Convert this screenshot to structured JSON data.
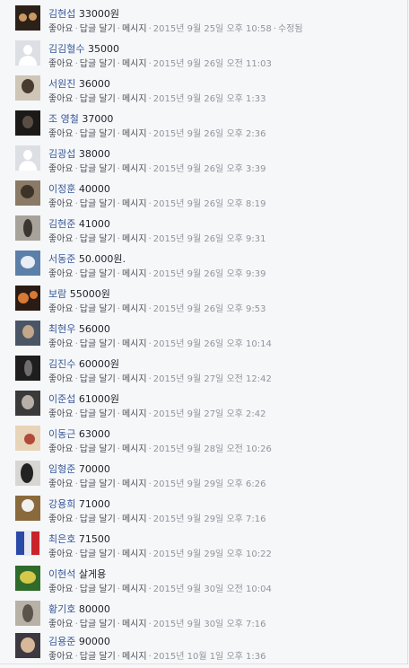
{
  "labels": {
    "like": "좋아요",
    "reply": "답글 달기",
    "message": "메시지",
    "edited": "수정됨"
  },
  "comments": [
    {
      "name": "김현섭",
      "text": "33000원",
      "time": "2015년 9월 25일 오후 10:58",
      "edited": true,
      "avatar": "photo",
      "avatar_color": "#2b2119",
      "accent": "#c99a63"
    },
    {
      "name": "김김혈수",
      "text": "35000",
      "time": "2015년 9월 26일 오전 11:03",
      "edited": false,
      "avatar": "default",
      "avatar_color": "#dcdfe4",
      "accent": "#ffffff"
    },
    {
      "name": "서원진",
      "text": "36000",
      "time": "2015년 9월 26일 오후 1:33",
      "edited": false,
      "avatar": "photo",
      "avatar_color": "#cfc6b8",
      "accent": "#4a3b30"
    },
    {
      "name": "조 영철",
      "text": "37000",
      "time": "2015년 9월 26일 오후 2:36",
      "edited": false,
      "avatar": "photo",
      "avatar_color": "#1b1a18",
      "accent": "#5a4e44"
    },
    {
      "name": "김광섭",
      "text": "38000",
      "time": "2015년 9월 26일 오후 3:39",
      "edited": false,
      "avatar": "default",
      "avatar_color": "#dcdfe4",
      "accent": "#ffffff"
    },
    {
      "name": "이정훈",
      "text": "40000",
      "time": "2015년 9월 26일 오후 8:19",
      "edited": false,
      "avatar": "photo",
      "avatar_color": "#8a7a66",
      "accent": "#3e3329"
    },
    {
      "name": "김현준",
      "text": "41000",
      "time": "2015년 9월 26일 오후 9:31",
      "edited": false,
      "avatar": "photo",
      "avatar_color": "#a8a39a",
      "accent": "#3b3631"
    },
    {
      "name": "서동준",
      "text": "50.000원.",
      "time": "2015년 9월 26일 오후 9:39",
      "edited": false,
      "avatar": "photo",
      "avatar_color": "#5b7fa8",
      "accent": "#e8eef5"
    },
    {
      "name": "보람",
      "text": "55000원",
      "time": "2015년 9월 26일 오후 9:53",
      "edited": false,
      "avatar": "photo",
      "avatar_color": "#2a1c14",
      "accent": "#d87a34"
    },
    {
      "name": "최현우",
      "text": "56000",
      "time": "2015년 9월 26일 오후 10:14",
      "edited": false,
      "avatar": "photo",
      "avatar_color": "#4a5566",
      "accent": "#c2a78a"
    },
    {
      "name": "김진수",
      "text": "60000원",
      "time": "2015년 9월 27일 오전 12:42",
      "edited": false,
      "avatar": "photo",
      "avatar_color": "#1e1e1e",
      "accent": "#6e6e6e"
    },
    {
      "name": "이준섭",
      "text": "61000원",
      "time": "2015년 9월 27일 오후 2:42",
      "edited": false,
      "avatar": "photo",
      "avatar_color": "#3a3a3a",
      "accent": "#b8b0a8"
    },
    {
      "name": "이동근",
      "text": "63000",
      "time": "2015년 9월 28일 오전 10:26",
      "edited": false,
      "avatar": "photo",
      "avatar_color": "#e8d4b8",
      "accent": "#b04a3a"
    },
    {
      "name": "임형준",
      "text": "70000",
      "time": "2015년 9월 29일 오후 6:26",
      "edited": false,
      "avatar": "photo",
      "avatar_color": "#d8d6d2",
      "accent": "#222222"
    },
    {
      "name": "강용희",
      "text": "71000",
      "time": "2015년 9월 29일 오후 7:16",
      "edited": false,
      "avatar": "photo",
      "avatar_color": "#8a6a3c",
      "accent": "#f0f0f0"
    },
    {
      "name": "최은호",
      "text": "71500",
      "time": "2015년 9월 29일 오후 10:22",
      "edited": false,
      "avatar": "photo",
      "avatar_color": "#e8e8f0",
      "accent": "#c8242a"
    },
    {
      "name": "이현석",
      "text": "살게용",
      "time": "2015년 9월 30일 오전 10:04",
      "edited": false,
      "avatar": "photo",
      "avatar_color": "#2f6b2a",
      "accent": "#d4c84a"
    },
    {
      "name": "황기호",
      "text": "80000",
      "time": "2015년 9월 30일 오후 7:16",
      "edited": false,
      "avatar": "photo",
      "avatar_color": "#b8b2a6",
      "accent": "#5a544c"
    },
    {
      "name": "김용준",
      "text": "90000",
      "time": "2015년 10월 1일 오후 1:36",
      "edited": false,
      "avatar": "photo",
      "avatar_color": "#3c3a40",
      "accent": "#d8b89a"
    }
  ]
}
